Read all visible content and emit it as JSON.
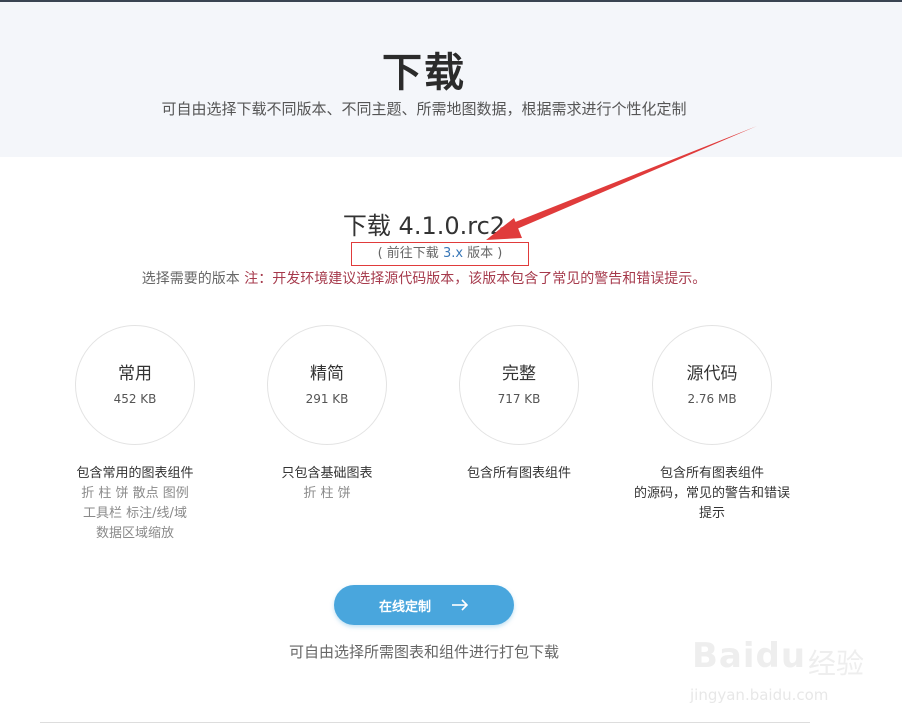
{
  "hero": {
    "title": "下载",
    "subtitle": "可自由选择下载不同版本、不同主题、所需地图数据，根据需求进行个性化定制"
  },
  "version": {
    "title": "下载 4.1.0.rc2",
    "prev_open": "( 前往下载 ",
    "prev_version": "3.x",
    "prev_close": " 版本 )",
    "note_prefix": "选择需要的版本",
    "note_warning": " 注：开发环境建议选择源代码版本，该版本包含了常见的警告和错误提示。"
  },
  "packages": [
    {
      "name": "常用",
      "size": "452 KB",
      "desc_main": "包含常用的图表组件",
      "desc_sub": [
        "折 柱 饼 散点 图例",
        "工具栏 标注/线/域",
        "数据区域缩放"
      ]
    },
    {
      "name": "精简",
      "size": "291 KB",
      "desc_main": "只包含基础图表",
      "desc_sub": [
        "折 柱 饼"
      ]
    },
    {
      "name": "完整",
      "size": "717 KB",
      "desc_main": "包含所有图表组件",
      "desc_sub": []
    },
    {
      "name": "源代码",
      "size": "2.76 MB",
      "desc_main": "包含所有图表组件\n的源码，常见的警告和错误\n提示",
      "desc_sub": []
    }
  ],
  "custom": {
    "button_label": "在线定制",
    "caption": "可自由选择所需图表和组件进行打包下载"
  },
  "watermark": {
    "logo": "Baidu",
    "cn": "经验",
    "url": "jingyan.baidu.com"
  },
  "colors": {
    "accent": "#49a6dd",
    "warning": "#a63a4c",
    "annotation": "#e03b3b"
  }
}
